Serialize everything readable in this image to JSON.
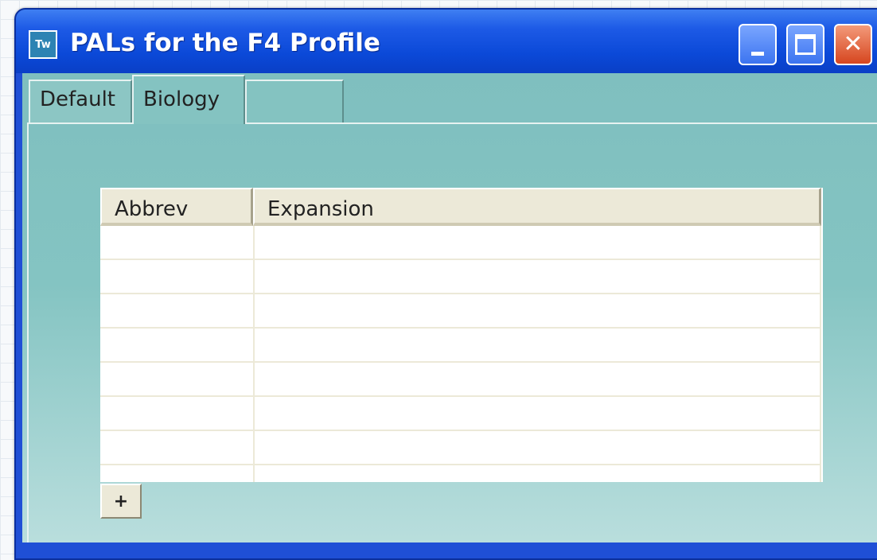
{
  "window": {
    "app_icon_text": "Tw",
    "title": "PALs for the F4 Profile",
    "controls": {
      "minimize": "minimize",
      "maximize": "maximize",
      "close": "close"
    }
  },
  "tabs": [
    {
      "label": "Default",
      "selected": false
    },
    {
      "label": "Biology",
      "selected": true
    },
    {
      "label": "",
      "selected": false
    }
  ],
  "grid": {
    "columns": [
      "Abbrev",
      "Expansion"
    ],
    "rows": [
      [
        "",
        ""
      ],
      [
        "",
        ""
      ],
      [
        "",
        ""
      ],
      [
        "",
        ""
      ],
      [
        "",
        ""
      ],
      [
        "",
        ""
      ],
      [
        "",
        ""
      ],
      [
        "",
        ""
      ]
    ]
  },
  "add_button_label": "+",
  "icons": {
    "app_icon": "app-icon",
    "minimize": "minimize-icon",
    "maximize": "maximize-icon",
    "close": "close-icon"
  }
}
